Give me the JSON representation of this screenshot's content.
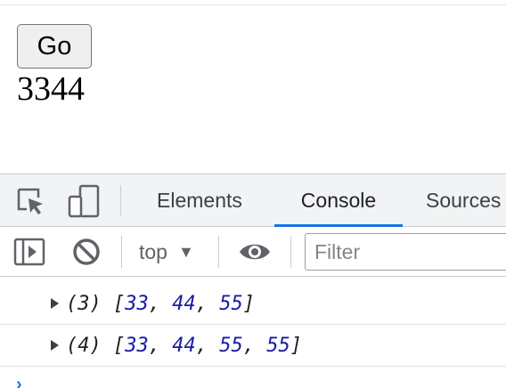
{
  "page": {
    "button_label": "Go",
    "output_text": "3344"
  },
  "devtools": {
    "tabs": [
      {
        "label": "Elements",
        "active": false
      },
      {
        "label": "Console",
        "active": true
      },
      {
        "label": "Sources",
        "active": false
      }
    ],
    "toolbar": {
      "context": "top",
      "filter_placeholder": "Filter"
    },
    "console": {
      "entries": [
        {
          "count": "(3)",
          "values": [
            "33",
            "44",
            "55"
          ]
        },
        {
          "count": "(4)",
          "values": [
            "33",
            "44",
            "55",
            "55"
          ]
        }
      ],
      "prompt_symbol": "›"
    },
    "icons": [
      "inspect-element-icon",
      "device-toolbar-icon",
      "console-sidebar-icon",
      "clear-console-icon",
      "live-expression-eye-icon"
    ],
    "colors": {
      "accent": "#1a73e8",
      "number": "#1a1aa6",
      "tabbar_bg": "#f1f3f4"
    }
  }
}
